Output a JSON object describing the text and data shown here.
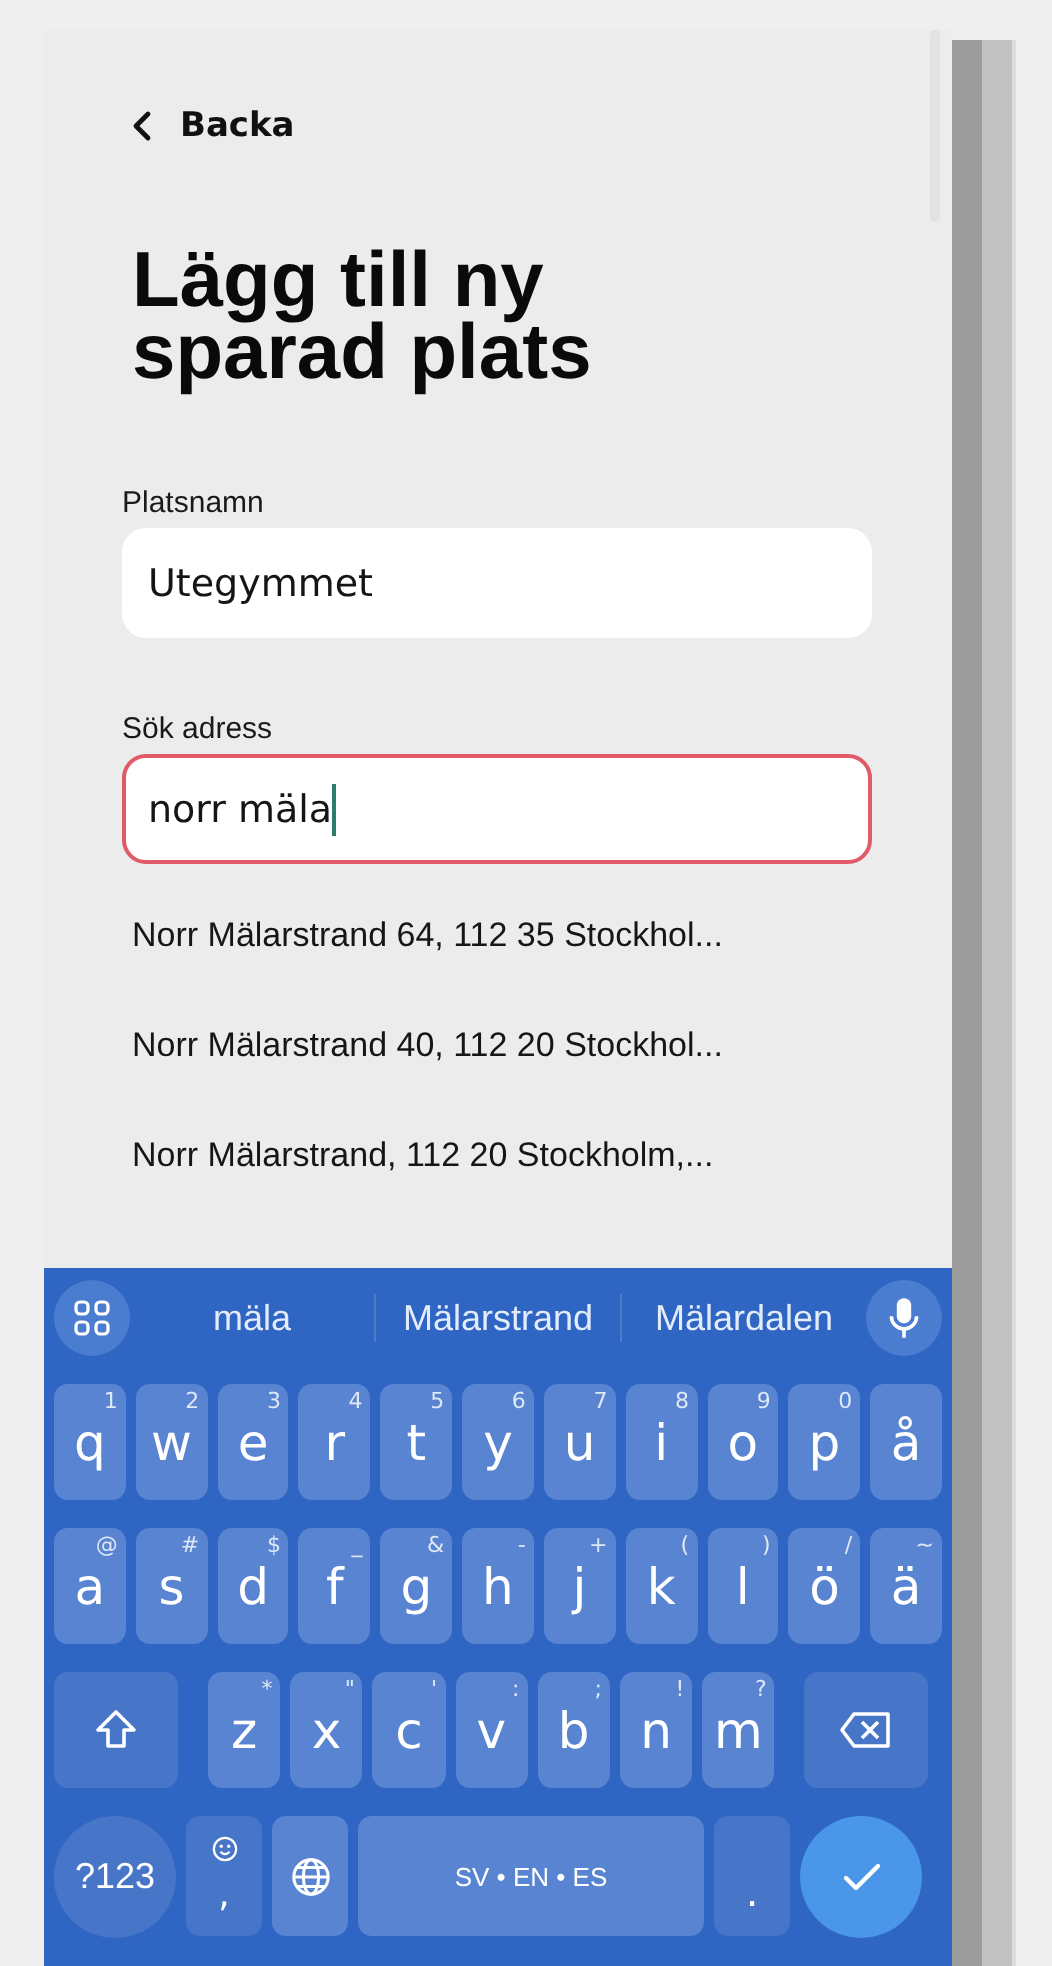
{
  "back": {
    "label": "Backa"
  },
  "title": "Lägg till ny sparad plats",
  "fields": [
    {
      "label": "Platsnamn",
      "value": "Utegymmet",
      "focused": false
    },
    {
      "label": "Sök adress",
      "value": "norr mäla",
      "focused": true
    }
  ],
  "suggestions": [
    "Norr Mälarstrand 64, 112 35 Stockhol...",
    "Norr Mälarstrand 40, 112 20 Stockhol...",
    "Norr Mälarstrand, 112 20 Stockholm,..."
  ],
  "keyboard": {
    "words": [
      "mäla",
      "Mälarstrand",
      "Mälardalen"
    ],
    "rows": [
      [
        {
          "kind": "letter",
          "label": "q",
          "hint": "1"
        },
        {
          "kind": "letter",
          "label": "w",
          "hint": "2"
        },
        {
          "kind": "letter",
          "label": "e",
          "hint": "3"
        },
        {
          "kind": "letter",
          "label": "r",
          "hint": "4"
        },
        {
          "kind": "letter",
          "label": "t",
          "hint": "5"
        },
        {
          "kind": "letter",
          "label": "y",
          "hint": "6"
        },
        {
          "kind": "letter",
          "label": "u",
          "hint": "7"
        },
        {
          "kind": "letter",
          "label": "i",
          "hint": "8"
        },
        {
          "kind": "letter",
          "label": "o",
          "hint": "9"
        },
        {
          "kind": "letter",
          "label": "p",
          "hint": "0"
        },
        {
          "kind": "letter",
          "label": "å"
        }
      ],
      [
        {
          "kind": "letter",
          "label": "a",
          "hint": "@"
        },
        {
          "kind": "letter",
          "label": "s",
          "hint": "#"
        },
        {
          "kind": "letter",
          "label": "d",
          "hint": "$"
        },
        {
          "kind": "letter",
          "label": "f",
          "hint": "_"
        },
        {
          "kind": "letter",
          "label": "g",
          "hint": "&"
        },
        {
          "kind": "letter",
          "label": "h",
          "hint": "-"
        },
        {
          "kind": "letter",
          "label": "j",
          "hint": "+"
        },
        {
          "kind": "letter",
          "label": "k",
          "hint": "("
        },
        {
          "kind": "letter",
          "label": "l",
          "hint": ")"
        },
        {
          "kind": "letter",
          "label": "ö",
          "hint": "/"
        },
        {
          "kind": "letter",
          "label": "ä",
          "hint": "~"
        }
      ],
      [
        {
          "kind": "shift"
        },
        "",
        {
          "kind": "letter",
          "label": "z",
          "hint": "*"
        },
        {
          "kind": "letter",
          "label": "x",
          "hint": "\""
        },
        {
          "kind": "letter",
          "label": "c",
          "hint": "'"
        },
        {
          "kind": "letter",
          "label": "v",
          "hint": ":"
        },
        {
          "kind": "letter",
          "label": "b",
          "hint": ";"
        },
        {
          "kind": "letter",
          "label": "n",
          "hint": "!"
        },
        {
          "kind": "letter",
          "label": "m",
          "hint": "?"
        },
        "",
        {
          "kind": "backspace"
        }
      ],
      [
        {
          "kind": "symbols",
          "label": "?123"
        },
        {
          "kind": "comma",
          "label": ","
        },
        {
          "kind": "globe"
        },
        "",
        "",
        {
          "kind": "space",
          "label": "SV • EN • ES"
        },
        "",
        "",
        {
          "kind": "period",
          "label": "."
        },
        {
          "kind": "enter"
        }
      ]
    ]
  }
}
